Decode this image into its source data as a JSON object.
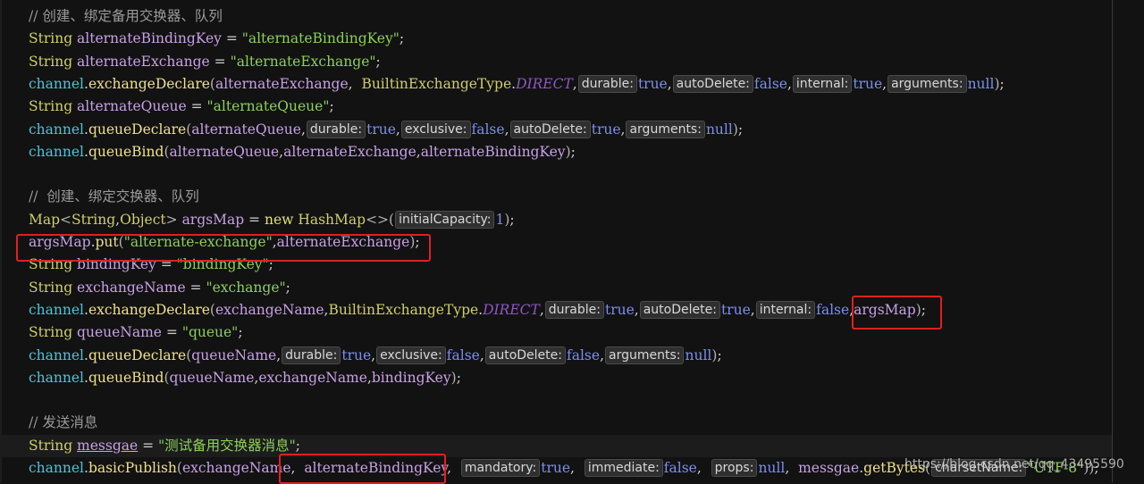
{
  "editor": {
    "lines": [
      {
        "tokens": [
          {
            "c": "cmt",
            "t": "// 创建、绑定备用交换器、队列"
          }
        ]
      },
      {
        "tokens": [
          {
            "c": "cls",
            "t": "String "
          },
          {
            "c": "var",
            "t": "alternateBindingKey"
          },
          {
            "c": "plain",
            "t": " = "
          },
          {
            "c": "str",
            "t": "\"alternateBindingKey\""
          },
          {
            "c": "plain",
            "t": ";"
          }
        ]
      },
      {
        "tokens": [
          {
            "c": "cls",
            "t": "String "
          },
          {
            "c": "var",
            "t": "alternateExchange"
          },
          {
            "c": "plain",
            "t": " = "
          },
          {
            "c": "str",
            "t": "\"alternateExchange\""
          },
          {
            "c": "plain",
            "t": ";"
          }
        ]
      },
      {
        "tokens": [
          {
            "c": "obj",
            "t": "channel"
          },
          {
            "c": "plain",
            "t": "."
          },
          {
            "c": "fn",
            "t": "exchangeDeclare"
          },
          {
            "c": "paren",
            "t": "("
          },
          {
            "c": "var",
            "t": "alternateExchange"
          },
          {
            "c": "plain",
            "t": ",  "
          },
          {
            "c": "cls",
            "t": "BuiltinExchangeType"
          },
          {
            "c": "plain",
            "t": "."
          },
          {
            "c": "const",
            "t": "DIRECT"
          },
          {
            "c": "plain",
            "t": ","
          },
          {
            "c": "hint",
            "t": "durable:"
          },
          {
            "c": "lit",
            "t": "true"
          },
          {
            "c": "plain",
            "t": ","
          },
          {
            "c": "hint",
            "t": "autoDelete:"
          },
          {
            "c": "lit",
            "t": "false"
          },
          {
            "c": "plain",
            "t": ","
          },
          {
            "c": "hint",
            "t": "internal:"
          },
          {
            "c": "lit",
            "t": "true"
          },
          {
            "c": "plain",
            "t": ","
          },
          {
            "c": "hint",
            "t": "arguments:"
          },
          {
            "c": "lit",
            "t": "null"
          },
          {
            "c": "paren",
            "t": ")"
          },
          {
            "c": "plain",
            "t": ";"
          }
        ]
      },
      {
        "tokens": [
          {
            "c": "cls",
            "t": "String "
          },
          {
            "c": "var",
            "t": "alternateQueue"
          },
          {
            "c": "plain",
            "t": " = "
          },
          {
            "c": "str",
            "t": "\"alternateQueue\""
          },
          {
            "c": "plain",
            "t": ";"
          }
        ]
      },
      {
        "tokens": [
          {
            "c": "obj",
            "t": "channel"
          },
          {
            "c": "plain",
            "t": "."
          },
          {
            "c": "fn",
            "t": "queueDeclare"
          },
          {
            "c": "paren",
            "t": "("
          },
          {
            "c": "var",
            "t": "alternateQueue"
          },
          {
            "c": "plain",
            "t": ","
          },
          {
            "c": "hint",
            "t": "durable:"
          },
          {
            "c": "lit",
            "t": "true"
          },
          {
            "c": "plain",
            "t": ","
          },
          {
            "c": "hint",
            "t": "exclusive:"
          },
          {
            "c": "lit",
            "t": "false"
          },
          {
            "c": "plain",
            "t": ","
          },
          {
            "c": "hint",
            "t": "autoDelete:"
          },
          {
            "c": "lit",
            "t": "true"
          },
          {
            "c": "plain",
            "t": ","
          },
          {
            "c": "hint",
            "t": "arguments:"
          },
          {
            "c": "lit",
            "t": "null"
          },
          {
            "c": "paren",
            "t": ")"
          },
          {
            "c": "plain",
            "t": ";"
          }
        ]
      },
      {
        "tokens": [
          {
            "c": "obj",
            "t": "channel"
          },
          {
            "c": "plain",
            "t": "."
          },
          {
            "c": "fn",
            "t": "queueBind"
          },
          {
            "c": "paren",
            "t": "("
          },
          {
            "c": "var",
            "t": "alternateQueue"
          },
          {
            "c": "plain",
            "t": ","
          },
          {
            "c": "var",
            "t": "alternateExchange"
          },
          {
            "c": "plain",
            "t": ","
          },
          {
            "c": "var",
            "t": "alternateBindingKey"
          },
          {
            "c": "paren",
            "t": ")"
          },
          {
            "c": "plain",
            "t": ";"
          }
        ]
      },
      {
        "tokens": []
      },
      {
        "tokens": [
          {
            "c": "cmt",
            "t": "//  创建、绑定交换器、队列"
          }
        ]
      },
      {
        "tokens": [
          {
            "c": "cls",
            "t": "Map"
          },
          {
            "c": "paren",
            "t": "<"
          },
          {
            "c": "cls",
            "t": "String"
          },
          {
            "c": "plain",
            "t": ","
          },
          {
            "c": "cls",
            "t": "Object"
          },
          {
            "c": "paren",
            "t": "> "
          },
          {
            "c": "var",
            "t": "argsMap"
          },
          {
            "c": "plain",
            "t": " = "
          },
          {
            "c": "kw2",
            "t": "new "
          },
          {
            "c": "cls",
            "t": "HashMap"
          },
          {
            "c": "paren",
            "t": "<>("
          },
          {
            "c": "hint",
            "t": "initialCapacity:"
          },
          {
            "c": "lit",
            "t": "1"
          },
          {
            "c": "paren",
            "t": ")"
          },
          {
            "c": "plain",
            "t": ";"
          }
        ]
      },
      {
        "tokens": [
          {
            "c": "var",
            "t": "argsMap"
          },
          {
            "c": "plain",
            "t": "."
          },
          {
            "c": "fn",
            "t": "put"
          },
          {
            "c": "paren",
            "t": "("
          },
          {
            "c": "str",
            "t": "\"alternate-exchange\""
          },
          {
            "c": "plain",
            "t": ","
          },
          {
            "c": "var",
            "t": "alternateExchange"
          },
          {
            "c": "paren",
            "t": ")"
          },
          {
            "c": "plain",
            "t": ";"
          }
        ]
      },
      {
        "tokens": [
          {
            "c": "cls",
            "t": "String "
          },
          {
            "c": "var",
            "t": "bindingKey"
          },
          {
            "c": "plain",
            "t": " = "
          },
          {
            "c": "str",
            "t": "\"bindingKey\""
          },
          {
            "c": "plain",
            "t": ";"
          }
        ]
      },
      {
        "tokens": [
          {
            "c": "cls",
            "t": "String "
          },
          {
            "c": "var",
            "t": "exchangeName"
          },
          {
            "c": "plain",
            "t": " = "
          },
          {
            "c": "str",
            "t": "\"exchange\""
          },
          {
            "c": "plain",
            "t": ";"
          }
        ]
      },
      {
        "tokens": [
          {
            "c": "obj",
            "t": "channel"
          },
          {
            "c": "plain",
            "t": "."
          },
          {
            "c": "fn",
            "t": "exchangeDeclare"
          },
          {
            "c": "paren",
            "t": "("
          },
          {
            "c": "var",
            "t": "exchangeName"
          },
          {
            "c": "plain",
            "t": ","
          },
          {
            "c": "cls",
            "t": "BuiltinExchangeType"
          },
          {
            "c": "plain",
            "t": "."
          },
          {
            "c": "const",
            "t": "DIRECT"
          },
          {
            "c": "plain",
            "t": ","
          },
          {
            "c": "hint",
            "t": "durable:"
          },
          {
            "c": "lit",
            "t": "true"
          },
          {
            "c": "plain",
            "t": ","
          },
          {
            "c": "hint",
            "t": "autoDelete:"
          },
          {
            "c": "lit",
            "t": "true"
          },
          {
            "c": "plain",
            "t": ","
          },
          {
            "c": "hint",
            "t": "internal:"
          },
          {
            "c": "lit",
            "t": "false"
          },
          {
            "c": "plain",
            "t": ","
          },
          {
            "c": "var",
            "t": "argsMap"
          },
          {
            "c": "paren",
            "t": ")"
          },
          {
            "c": "plain",
            "t": ";"
          }
        ]
      },
      {
        "tokens": [
          {
            "c": "cls",
            "t": "String "
          },
          {
            "c": "var",
            "t": "queueName"
          },
          {
            "c": "plain",
            "t": " = "
          },
          {
            "c": "str",
            "t": "\"queue\""
          },
          {
            "c": "plain",
            "t": ";"
          }
        ]
      },
      {
        "tokens": [
          {
            "c": "obj",
            "t": "channel"
          },
          {
            "c": "plain",
            "t": "."
          },
          {
            "c": "fn",
            "t": "queueDeclare"
          },
          {
            "c": "paren",
            "t": "("
          },
          {
            "c": "var",
            "t": "queueName"
          },
          {
            "c": "plain",
            "t": ","
          },
          {
            "c": "hint",
            "t": "durable:"
          },
          {
            "c": "lit",
            "t": "true"
          },
          {
            "c": "plain",
            "t": ","
          },
          {
            "c": "hint",
            "t": "exclusive:"
          },
          {
            "c": "lit",
            "t": "false"
          },
          {
            "c": "plain",
            "t": ","
          },
          {
            "c": "hint",
            "t": "autoDelete:"
          },
          {
            "c": "lit",
            "t": "false"
          },
          {
            "c": "plain",
            "t": ","
          },
          {
            "c": "hint",
            "t": "arguments:"
          },
          {
            "c": "lit",
            "t": "null"
          },
          {
            "c": "paren",
            "t": ")"
          },
          {
            "c": "plain",
            "t": ";"
          }
        ]
      },
      {
        "tokens": [
          {
            "c": "obj",
            "t": "channel"
          },
          {
            "c": "plain",
            "t": "."
          },
          {
            "c": "fn",
            "t": "queueBind"
          },
          {
            "c": "paren",
            "t": "("
          },
          {
            "c": "var",
            "t": "queueName"
          },
          {
            "c": "plain",
            "t": ","
          },
          {
            "c": "var",
            "t": "exchangeName"
          },
          {
            "c": "plain",
            "t": ","
          },
          {
            "c": "var",
            "t": "bindingKey"
          },
          {
            "c": "paren",
            "t": ")"
          },
          {
            "c": "plain",
            "t": ";"
          }
        ]
      },
      {
        "tokens": []
      },
      {
        "tokens": [
          {
            "c": "cmt",
            "t": "// 发送消息"
          }
        ]
      },
      {
        "tokens": [
          {
            "c": "cls",
            "t": "String "
          },
          {
            "c": "var under",
            "t": "messgae"
          },
          {
            "c": "plain",
            "t": " = "
          },
          {
            "c": "str",
            "t": "\"测试备用交换器消息\""
          },
          {
            "c": "plain",
            "t": ";"
          }
        ]
      },
      {
        "tokens": [
          {
            "c": "obj",
            "t": "channel"
          },
          {
            "c": "plain",
            "t": "."
          },
          {
            "c": "fn",
            "t": "basicPublish"
          },
          {
            "c": "paren",
            "t": "("
          },
          {
            "c": "var",
            "t": "exchangeName"
          },
          {
            "c": "plain",
            "t": ",  "
          },
          {
            "c": "var",
            "t": "alternateBindingKey"
          },
          {
            "c": "plain",
            "t": ",  "
          },
          {
            "c": "hint",
            "t": "mandatory:"
          },
          {
            "c": "lit",
            "t": "true"
          },
          {
            "c": "plain",
            "t": ",  "
          },
          {
            "c": "hint",
            "t": "immediate:"
          },
          {
            "c": "lit",
            "t": "false"
          },
          {
            "c": "plain",
            "t": ",  "
          },
          {
            "c": "hint",
            "t": "props:"
          },
          {
            "c": "lit",
            "t": "null"
          },
          {
            "c": "plain",
            "t": ",  "
          },
          {
            "c": "var",
            "t": "messgae"
          },
          {
            "c": "plain",
            "t": "."
          },
          {
            "c": "fn",
            "t": "getBytes"
          },
          {
            "c": "paren",
            "t": "("
          },
          {
            "c": "hint",
            "t": "charsetName:"
          },
          {
            "c": "str",
            "t": "\"UTF-8\""
          },
          {
            "c": "paren",
            "t": "))"
          },
          {
            "c": "plain",
            "t": ";"
          }
        ]
      }
    ]
  },
  "watermark": {
    "text": "https://blog.csdn.net/qq_43495590"
  },
  "colors": {
    "background": "#121212",
    "highlight_box": "#e02020"
  }
}
